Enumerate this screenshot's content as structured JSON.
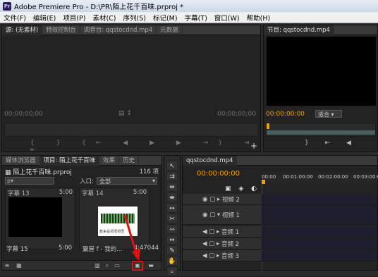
{
  "window": {
    "title": "Adobe Premiere Pro - D:\\PR\\陌上花千百味.prproj *"
  },
  "menu": [
    "文件(F)",
    "编辑(E)",
    "项目(P)",
    "素材(C)",
    "序列(S)",
    "标记(M)",
    "字幕(T)",
    "窗口(W)",
    "帮助(H)"
  ],
  "source_panel": {
    "tabs": [
      "源: (无素材)",
      "特效控制台",
      "调音台: qqstocdnd.mp4",
      "元数据"
    ],
    "timecode_left": "00;00;00;00",
    "timecode_right": "00;00;00;00"
  },
  "program_panel": {
    "tab": "节目: qqstocdnd.mp4",
    "timecode": "00:00:00:00",
    "fit": "适合"
  },
  "project_panel": {
    "tabs": [
      "媒体浏览器",
      "项目: 陌上花千百味",
      "效果",
      "历史"
    ],
    "project_file": "陌上花千百味.prproj",
    "item_count": "116 项",
    "search_placeholder": "ρ▾",
    "in_label": "入口:",
    "in_value": "全部",
    "cells": [
      {
        "label": "字幕 13",
        "duration": "5:00"
      },
      {
        "label": "字幕 14",
        "duration": "5:00"
      },
      {
        "label": "字幕 15",
        "duration": "5:00"
      },
      {
        "label": "赢屋 f - 我的...",
        "duration": "4:47044"
      }
    ],
    "thumb_caption": "教来是领悟领悟"
  },
  "timeline": {
    "tab": "qqstocdnd.mp4",
    "timecode": "00:00:00:00",
    "ruler": [
      "00:00",
      "00:01:00:00",
      "00:02:00:00",
      "00:03:00:00"
    ],
    "tracks": [
      {
        "name": "视频 2"
      },
      {
        "name": "视频 1"
      },
      {
        "name": "音频 1"
      },
      {
        "name": "音频 2"
      },
      {
        "name": "音频 3"
      }
    ]
  },
  "colors": {
    "accent": "#f0a000",
    "highlight_box": "#e01010"
  }
}
